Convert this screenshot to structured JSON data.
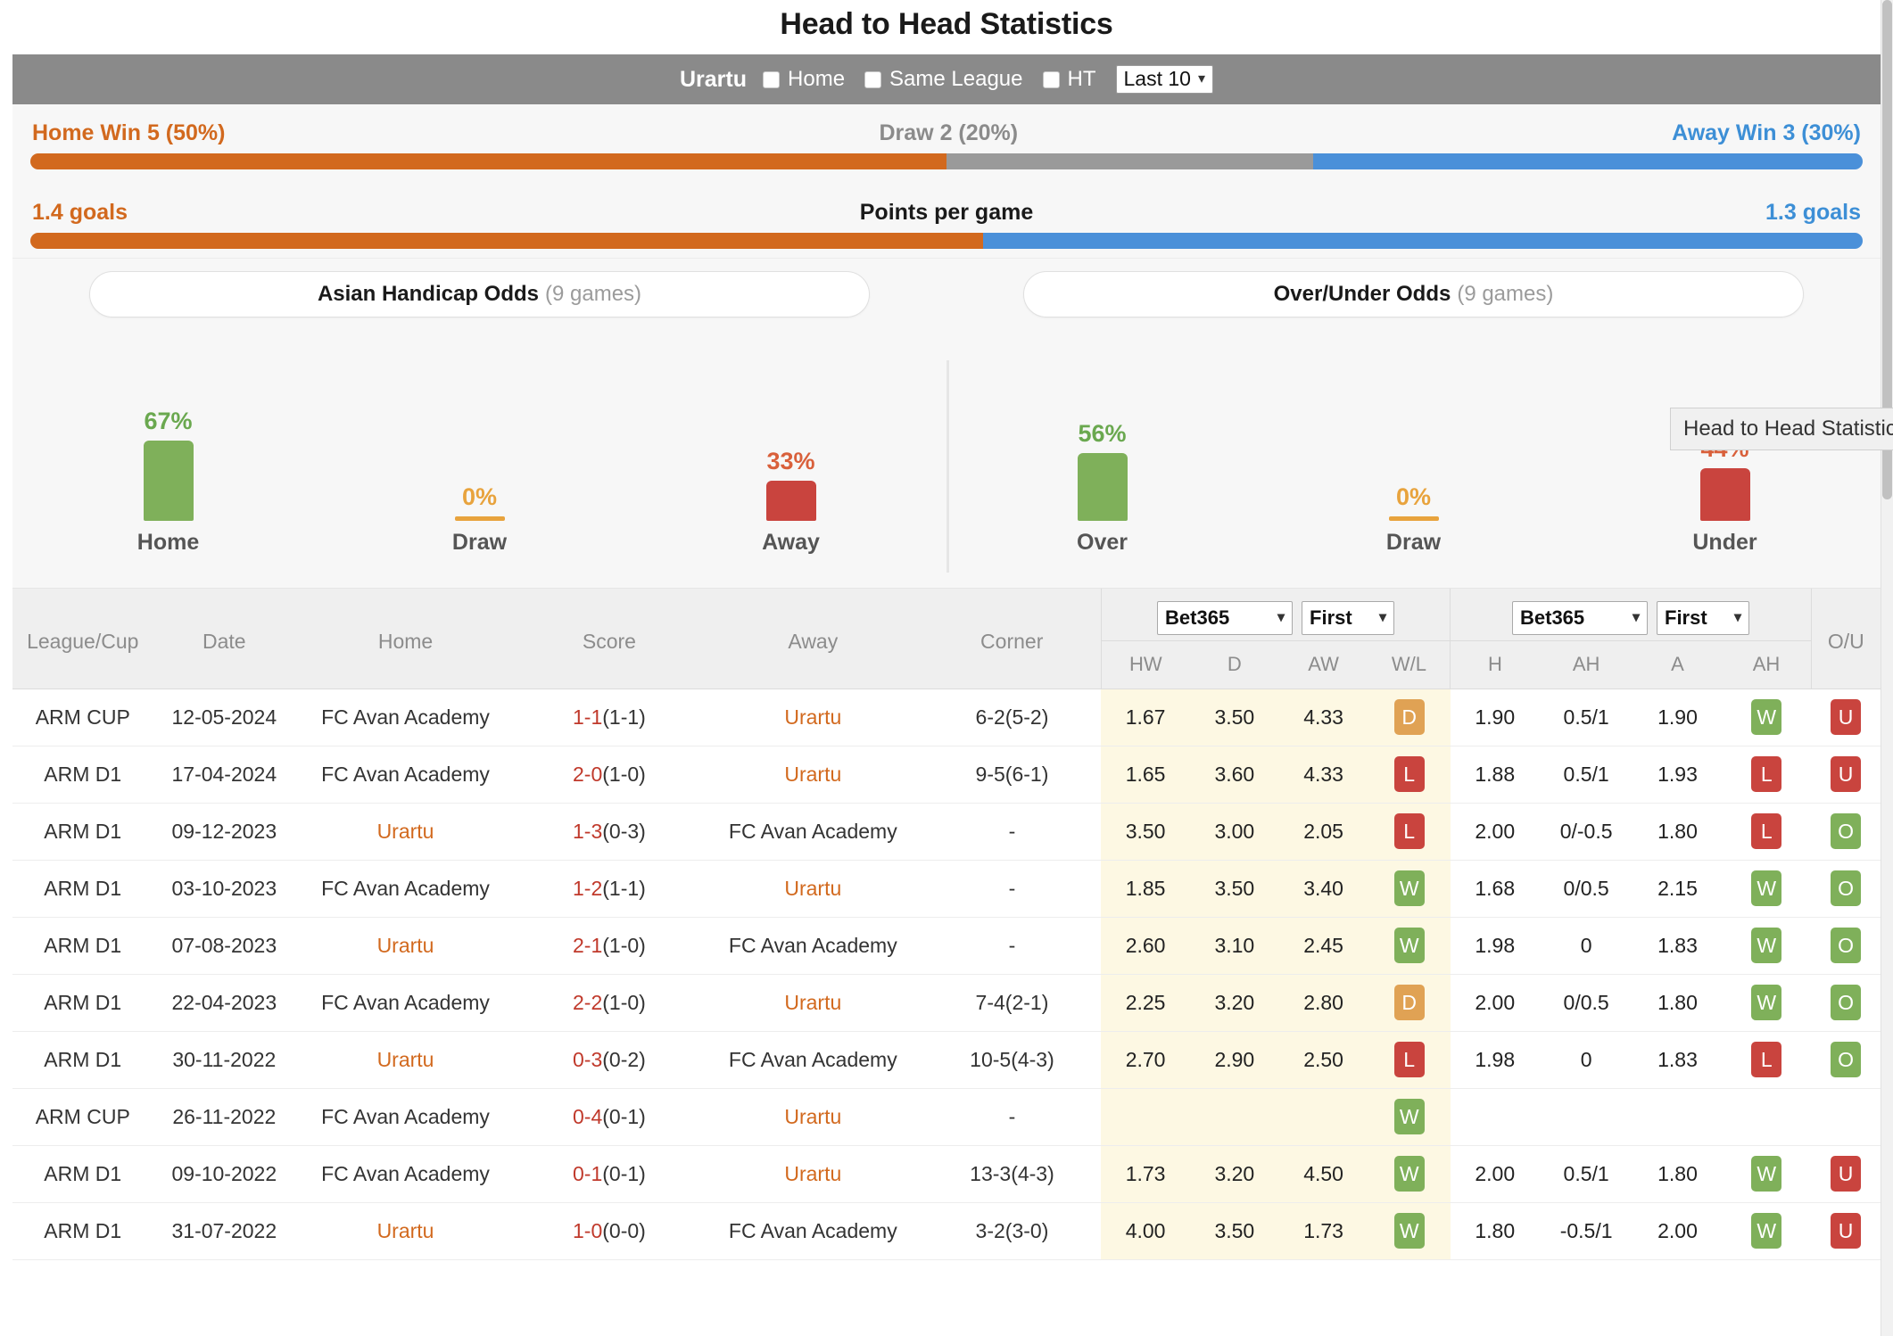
{
  "header": {
    "title": "Head to Head Statistics"
  },
  "filter_bar": {
    "team": "Urartu",
    "checkboxes": [
      {
        "label": "Home",
        "checked": false
      },
      {
        "label": "Same League",
        "checked": false
      },
      {
        "label": "HT",
        "checked": false
      }
    ],
    "range_select": {
      "value": "Last 10",
      "caret": "chevron-down-icon"
    }
  },
  "summary": {
    "home_win": "Home Win 5 (50%)",
    "draw": "Draw 2 (20%)",
    "away_win": "Away Win 3 (30%)",
    "home_pct": 50,
    "draw_pct": 20,
    "away_pct": 30,
    "ppg_title": "Points per game",
    "ppg_home": "1.4 goals",
    "ppg_away": "1.3 goals",
    "ppg_home_pct": 52,
    "ppg_away_pct": 48
  },
  "odds_buttons": {
    "asian": {
      "label": "Asian Handicap Odds",
      "games": "(9 games)"
    },
    "overunder": {
      "label": "Over/Under Odds",
      "games": "(9 games)"
    }
  },
  "tooltip": {
    "text": "Head to Head Statistics"
  },
  "chart_data": [
    {
      "type": "bar",
      "title": "Asian Handicap Odds",
      "categories": [
        "Home",
        "Draw",
        "Away"
      ],
      "values": [
        67,
        0,
        33
      ],
      "labels": [
        "67%",
        "0%",
        "33%"
      ],
      "colors": [
        "#7fb05a",
        "#e8a33d",
        "#c9443e"
      ],
      "label_colors": [
        "#6aa84f",
        "#e8a33d",
        "#d9603b"
      ],
      "ylabel": "",
      "xlabel": "",
      "ylim": [
        0,
        100
      ],
      "grid": false,
      "legend": "none"
    },
    {
      "type": "bar",
      "title": "Over/Under Odds",
      "categories": [
        "Over",
        "Draw",
        "Under"
      ],
      "values": [
        56,
        0,
        44
      ],
      "labels": [
        "56%",
        "0%",
        "44%"
      ],
      "colors": [
        "#7fb05a",
        "#e8a33d",
        "#c9443e"
      ],
      "label_colors": [
        "#6aa84f",
        "#e8a33d",
        "#d9603b"
      ],
      "ylabel": "",
      "xlabel": "",
      "ylim": [
        0,
        100
      ],
      "grid": false,
      "legend": "none"
    }
  ],
  "table": {
    "main_headers": [
      "League/Cup",
      "Date",
      "Home",
      "Score",
      "Away",
      "Corner"
    ],
    "ou_header": "O/U",
    "group_1": {
      "bookmaker": "Bet365",
      "phase": "First",
      "sub_headers": [
        "HW",
        "D",
        "AW",
        "W/L"
      ]
    },
    "group_2": {
      "bookmaker": "Bet365",
      "phase": "First",
      "sub_headers": [
        "H",
        "AH",
        "A",
        "AH"
      ]
    },
    "rows": [
      {
        "league": "ARM CUP",
        "date": "12-05-2024",
        "home": "FC Avan Academy",
        "home_hl": false,
        "score_main": "1-1",
        "score_sub": "(1-1)",
        "away": "Urartu",
        "away_hl": true,
        "corner": "6-2(5-2)",
        "hw": "1.67",
        "d": "3.50",
        "aw": "4.33",
        "wl": "D",
        "wl_cls": "bg-d",
        "h": "1.90",
        "ah1": "0.5/1",
        "a": "1.90",
        "ah2": "W",
        "ah2_cls": "bg-w",
        "ou": "U",
        "ou_cls": "bg-u"
      },
      {
        "league": "ARM D1",
        "date": "17-04-2024",
        "home": "FC Avan Academy",
        "home_hl": false,
        "score_main": "2-0",
        "score_sub": "(1-0)",
        "away": "Urartu",
        "away_hl": true,
        "corner": "9-5(6-1)",
        "hw": "1.65",
        "d": "3.60",
        "aw": "4.33",
        "wl": "L",
        "wl_cls": "bg-l",
        "h": "1.88",
        "ah1": "0.5/1",
        "a": "1.93",
        "ah2": "L",
        "ah2_cls": "bg-l",
        "ou": "U",
        "ou_cls": "bg-u"
      },
      {
        "league": "ARM D1",
        "date": "09-12-2023",
        "home": "Urartu",
        "home_hl": true,
        "score_main": "1-3",
        "score_sub": "(0-3)",
        "away": "FC Avan Academy",
        "away_hl": false,
        "corner": "-",
        "hw": "3.50",
        "d": "3.00",
        "aw": "2.05",
        "wl": "L",
        "wl_cls": "bg-l",
        "h": "2.00",
        "ah1": "0/-0.5",
        "a": "1.80",
        "ah2": "L",
        "ah2_cls": "bg-l",
        "ou": "O",
        "ou_cls": "bg-o"
      },
      {
        "league": "ARM D1",
        "date": "03-10-2023",
        "home": "FC Avan Academy",
        "home_hl": false,
        "score_main": "1-2",
        "score_sub": "(1-1)",
        "away": "Urartu",
        "away_hl": true,
        "corner": "-",
        "hw": "1.85",
        "d": "3.50",
        "aw": "3.40",
        "wl": "W",
        "wl_cls": "bg-w",
        "h": "1.68",
        "ah1": "0/0.5",
        "a": "2.15",
        "ah2": "W",
        "ah2_cls": "bg-w",
        "ou": "O",
        "ou_cls": "bg-o"
      },
      {
        "league": "ARM D1",
        "date": "07-08-2023",
        "home": "Urartu",
        "home_hl": true,
        "score_main": "2-1",
        "score_sub": "(1-0)",
        "away": "FC Avan Academy",
        "away_hl": false,
        "corner": "-",
        "hw": "2.60",
        "d": "3.10",
        "aw": "2.45",
        "wl": "W",
        "wl_cls": "bg-w",
        "h": "1.98",
        "ah1": "0",
        "a": "1.83",
        "ah2": "W",
        "ah2_cls": "bg-w",
        "ou": "O",
        "ou_cls": "bg-o"
      },
      {
        "league": "ARM D1",
        "date": "22-04-2023",
        "home": "FC Avan Academy",
        "home_hl": false,
        "score_main": "2-2",
        "score_sub": "(1-0)",
        "away": "Urartu",
        "away_hl": true,
        "corner": "7-4(2-1)",
        "hw": "2.25",
        "d": "3.20",
        "aw": "2.80",
        "wl": "D",
        "wl_cls": "bg-d",
        "h": "2.00",
        "ah1": "0/0.5",
        "a": "1.80",
        "ah2": "W",
        "ah2_cls": "bg-w",
        "ou": "O",
        "ou_cls": "bg-o"
      },
      {
        "league": "ARM D1",
        "date": "30-11-2022",
        "home": "Urartu",
        "home_hl": true,
        "score_main": "0-3",
        "score_sub": "(0-2)",
        "away": "FC Avan Academy",
        "away_hl": false,
        "corner": "10-5(4-3)",
        "hw": "2.70",
        "d": "2.90",
        "aw": "2.50",
        "wl": "L",
        "wl_cls": "bg-l",
        "h": "1.98",
        "ah1": "0",
        "a": "1.83",
        "ah2": "L",
        "ah2_cls": "bg-l",
        "ou": "O",
        "ou_cls": "bg-o"
      },
      {
        "league": "ARM CUP",
        "date": "26-11-2022",
        "home": "FC Avan Academy",
        "home_hl": false,
        "score_main": "0-4",
        "score_sub": "(0-1)",
        "away": "Urartu",
        "away_hl": true,
        "corner": "-",
        "hw": "",
        "d": "",
        "aw": "",
        "wl": "W",
        "wl_cls": "bg-w",
        "h": "",
        "ah1": "",
        "a": "",
        "ah2": "",
        "ah2_cls": "",
        "ou": "",
        "ou_cls": ""
      },
      {
        "league": "ARM D1",
        "date": "09-10-2022",
        "home": "FC Avan Academy",
        "home_hl": false,
        "score_main": "0-1",
        "score_sub": "(0-1)",
        "away": "Urartu",
        "away_hl": true,
        "corner": "13-3(4-3)",
        "hw": "1.73",
        "d": "3.20",
        "aw": "4.50",
        "wl": "W",
        "wl_cls": "bg-w",
        "h": "2.00",
        "ah1": "0.5/1",
        "a": "1.80",
        "ah2": "W",
        "ah2_cls": "bg-w",
        "ou": "U",
        "ou_cls": "bg-u"
      },
      {
        "league": "ARM D1",
        "date": "31-07-2022",
        "home": "Urartu",
        "home_hl": true,
        "score_main": "1-0",
        "score_sub": "(0-0)",
        "away": "FC Avan Academy",
        "away_hl": false,
        "corner": "3-2(3-0)",
        "hw": "4.00",
        "d": "3.50",
        "aw": "1.73",
        "wl": "W",
        "wl_cls": "bg-w",
        "h": "1.80",
        "ah1": "-0.5/1",
        "a": "2.00",
        "ah2": "W",
        "ah2_cls": "bg-w",
        "ou": "U",
        "ou_cls": "bg-u"
      }
    ]
  }
}
